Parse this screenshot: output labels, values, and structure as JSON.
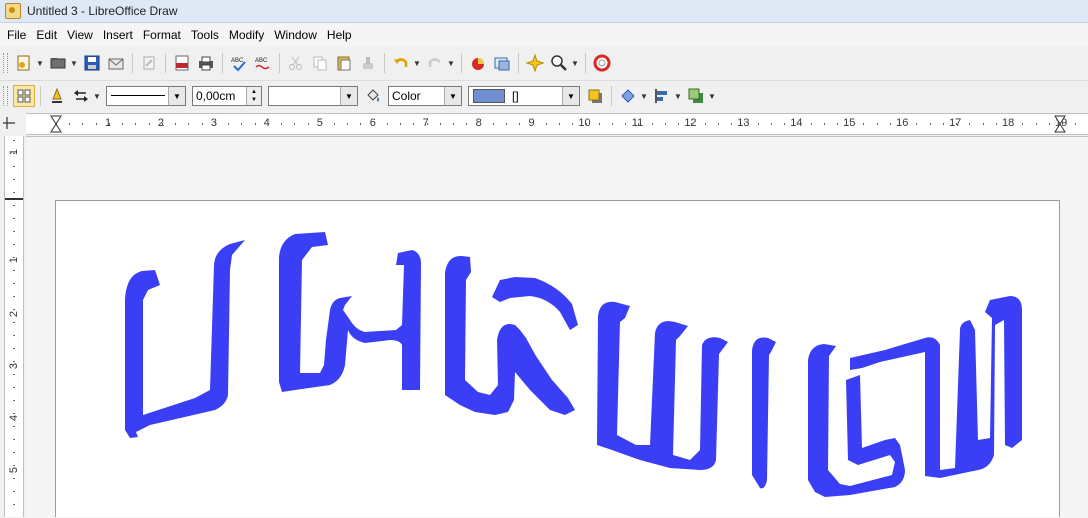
{
  "window": {
    "title": "Untitled 3 - LibreOffice Draw"
  },
  "menu": [
    {
      "u": "F",
      "rest": "ile"
    },
    {
      "u": "E",
      "rest": "dit"
    },
    {
      "u": "V",
      "rest": "iew"
    },
    {
      "u": "I",
      "rest": "nsert"
    },
    {
      "u": "",
      "rest": "Format",
      "pre": "F",
      "under_index": 1
    },
    {
      "u": "T",
      "rest": "ools"
    },
    {
      "u": "M",
      "rest": "odify"
    },
    {
      "u": "W",
      "rest": "indow"
    },
    {
      "u": "H",
      "rest": "elp"
    }
  ],
  "menu_labels": [
    "File",
    "Edit",
    "View",
    "Insert",
    "Format",
    "Tools",
    "Modify",
    "Window",
    "Help"
  ],
  "line_properties": {
    "line_width": "0,00cm",
    "area_style": "Color",
    "area_color_name": "[]",
    "area_color": "#6f8fd1"
  },
  "hruler": {
    "labels": [
      "1",
      "2",
      "3",
      "4",
      "5",
      "6",
      "7",
      "8",
      "9",
      "10",
      "11",
      "12",
      "13",
      "14",
      "15",
      "16",
      "17",
      "18",
      "19"
    ]
  },
  "vruler": {
    "labels": [
      "1",
      "1",
      "2",
      "3",
      "4",
      "5"
    ]
  },
  "drawing": {
    "fill_color": "#3a3ff5"
  }
}
